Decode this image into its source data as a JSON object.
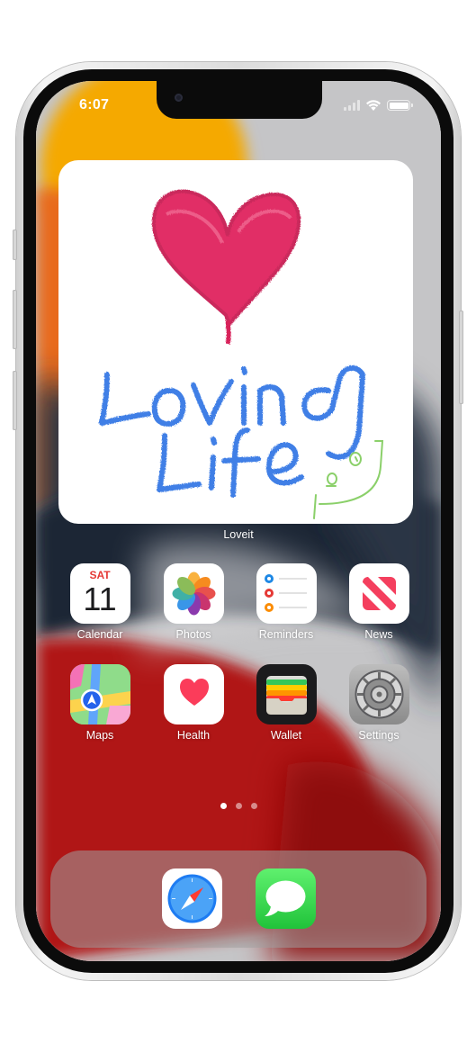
{
  "status_bar": {
    "time": "6:07"
  },
  "widget": {
    "label": "Loveit"
  },
  "apps": [
    {
      "label": "Calendar",
      "icon": "calendar-icon",
      "day": "SAT",
      "date": "11"
    },
    {
      "label": "Photos",
      "icon": "photos-icon"
    },
    {
      "label": "Reminders",
      "icon": "reminders-icon"
    },
    {
      "label": "News",
      "icon": "news-icon"
    },
    {
      "label": "Maps",
      "icon": "maps-icon"
    },
    {
      "label": "Health",
      "icon": "health-icon"
    },
    {
      "label": "Wallet",
      "icon": "wallet-icon"
    },
    {
      "label": "Settings",
      "icon": "settings-icon"
    }
  ],
  "dock": [
    {
      "app": "Safari",
      "icon": "safari-icon"
    },
    {
      "app": "Messages",
      "icon": "messages-icon"
    }
  ],
  "page_indicator": {
    "pages": 3,
    "current": 1
  },
  "colors": {
    "heart": "#e0245e",
    "handwriting": "#3f7fe6",
    "doodle": "#8bd06a"
  }
}
